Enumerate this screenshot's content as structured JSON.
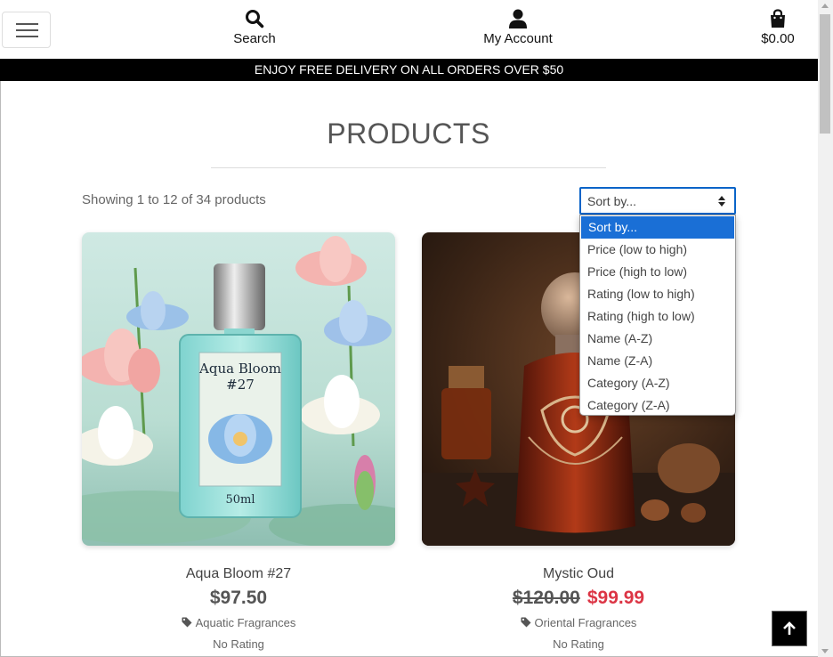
{
  "header": {
    "menu_icon": "hamburger-icon",
    "search_label": "Search",
    "search_icon": "search-icon",
    "account_label": "My Account",
    "account_icon": "user-icon",
    "cart_total": "$0.00",
    "cart_icon": "shopping-bag-icon"
  },
  "banner": "ENJOY FREE DELIVERY ON ALL ORDERS OVER $50",
  "page": {
    "title": "PRODUCTS",
    "count_text": "Showing 1 to 12 of 34 products"
  },
  "sort": {
    "selected": "Sort by...",
    "options": [
      "Sort by...",
      "Price (low to high)",
      "Price (high to low)",
      "Rating (low to high)",
      "Rating (high to low)",
      "Name (A-Z)",
      "Name (Z-A)",
      "Category (A-Z)",
      "Category (Z-A)"
    ]
  },
  "products": [
    {
      "name": "Aqua Bloom #27",
      "price": "$97.50",
      "category": "Aquatic Fragrances",
      "rating": "No Rating",
      "bottle_label_1": "Aqua Bloom",
      "bottle_label_2": "#27",
      "bottle_size": "50ml"
    },
    {
      "name": "Mystic Oud",
      "old_price": "$120.00",
      "price": "$99.99",
      "category": "Oriental Fragrances",
      "rating": "No Rating"
    }
  ],
  "colors": {
    "accent": "#1a6fd6",
    "sale": "#dc3545",
    "banner_bg": "#000000"
  },
  "back_to_top_icon": "arrow-up-icon"
}
